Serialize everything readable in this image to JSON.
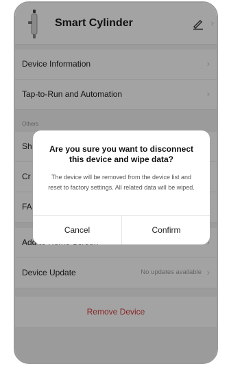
{
  "header": {
    "device_name": "Smart Cylinder",
    "icon": "cylinder-device-icon",
    "edit_icon": "pencil-icon"
  },
  "menu": {
    "device_information": "Device Information",
    "tap_to_run": "Tap-to-Run and Automation",
    "section_others": "Others",
    "share_partial": "Sh",
    "create_group_partial": "Cr",
    "faq_partial": "FA",
    "add_home_partial": "Add to Home Screen",
    "device_update": "Device Update",
    "device_update_value": "No updates available",
    "remove_device": "Remove Device"
  },
  "dialog": {
    "title": "Are you sure you want to disconnect this device and wipe data?",
    "message": "The device will be removed from the device list and reset to factory settings. All related data will be wiped.",
    "cancel": "Cancel",
    "confirm": "Confirm"
  },
  "colors": {
    "destructive": "#d43c3c",
    "overlay": "rgba(0,0,0,0.36)"
  }
}
